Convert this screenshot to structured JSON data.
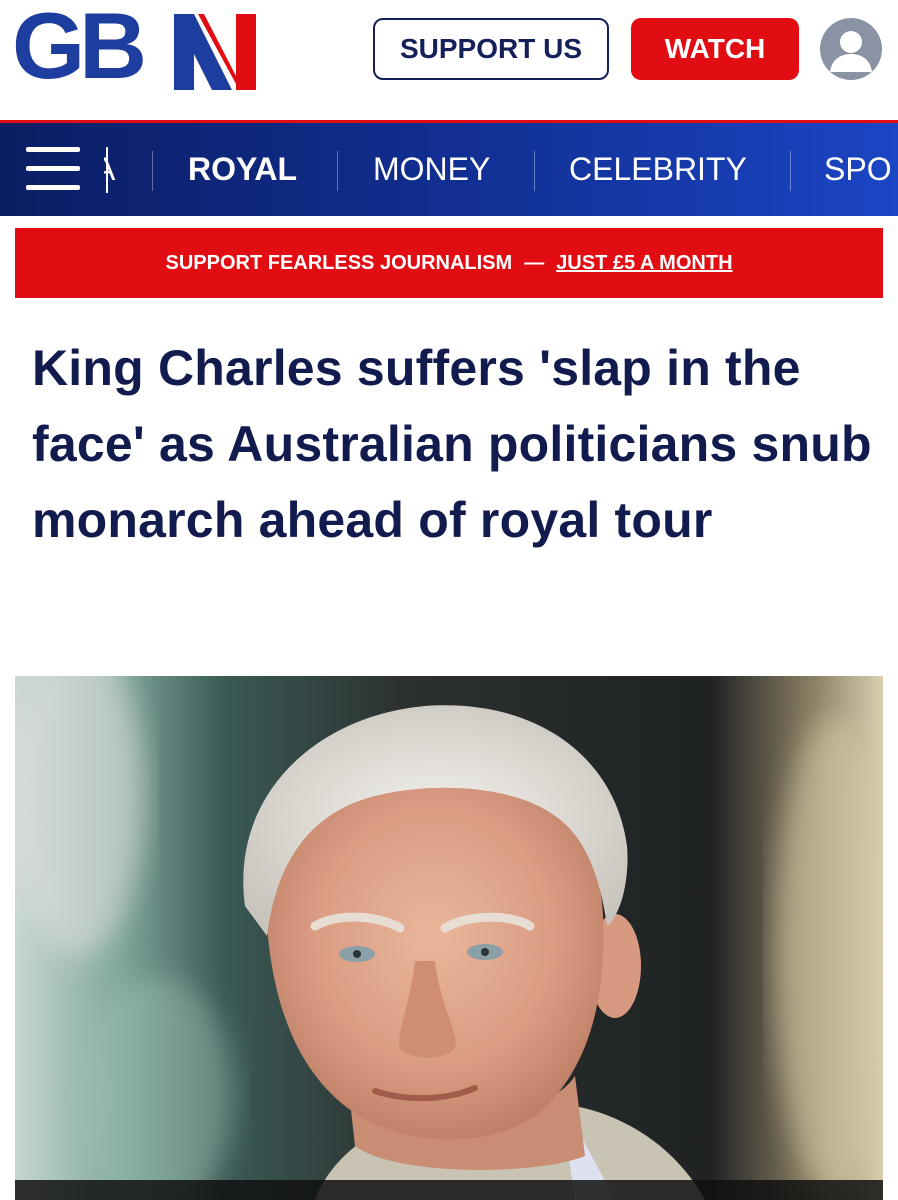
{
  "brand": {
    "logo_text": "GB",
    "colors": {
      "navy": "#1d3d9f",
      "red": "#e10d13",
      "nav_dark": "#0b1e63",
      "headline": "#111b4e"
    }
  },
  "header": {
    "support_label": "SUPPORT US",
    "watch_label": "WATCH",
    "account_icon": "user-avatar-icon"
  },
  "nav": {
    "menu_icon": "hamburger-menu-icon",
    "items": [
      {
        "label": "ROYAL",
        "active": true
      },
      {
        "label": "MONEY",
        "active": false
      },
      {
        "label": "CELEBRITY",
        "active": false
      },
      {
        "label": "SPO",
        "active": false
      }
    ]
  },
  "promo": {
    "text": "SUPPORT FEARLESS JOURNALISM",
    "separator": "—",
    "link": "JUST £5 A MONTH"
  },
  "article": {
    "headline": "King Charles suffers 'slap in the face' as Australian politicians snub monarch ahead of royal tour"
  }
}
